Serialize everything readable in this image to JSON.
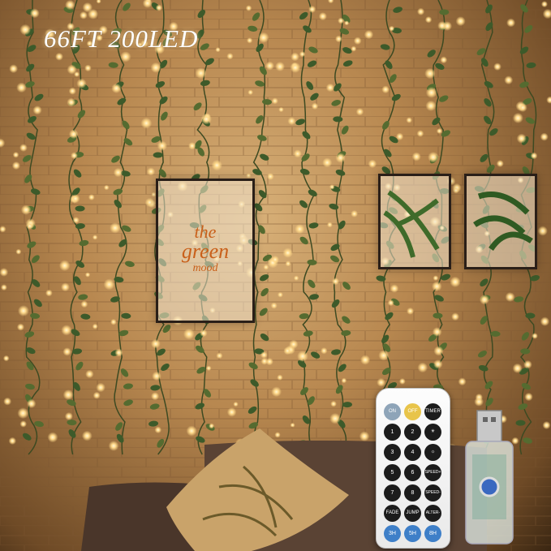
{
  "headline": "66FT 200LED",
  "poster": {
    "line1": "the",
    "line2": "green",
    "line3": "mood"
  },
  "remote": {
    "buttons": [
      "ON",
      "OFF",
      "TIMER",
      "1",
      "2",
      "☀",
      "3",
      "4",
      "☼",
      "5",
      "6",
      "SPEED+",
      "7",
      "8",
      "SPEED-",
      "FADE",
      "JUMP",
      "ALTER-NATE",
      "3H",
      "5H",
      "8H"
    ]
  },
  "icons": [
    "remote-control",
    "usb-controller",
    "cushion",
    "sofa"
  ],
  "colors": {
    "light": "#ffd98a",
    "leaf": "#3d5a2a",
    "brick": "#c9a06a",
    "off_button": "#e8c44a",
    "timer_buttons": "#3e7fc8"
  }
}
